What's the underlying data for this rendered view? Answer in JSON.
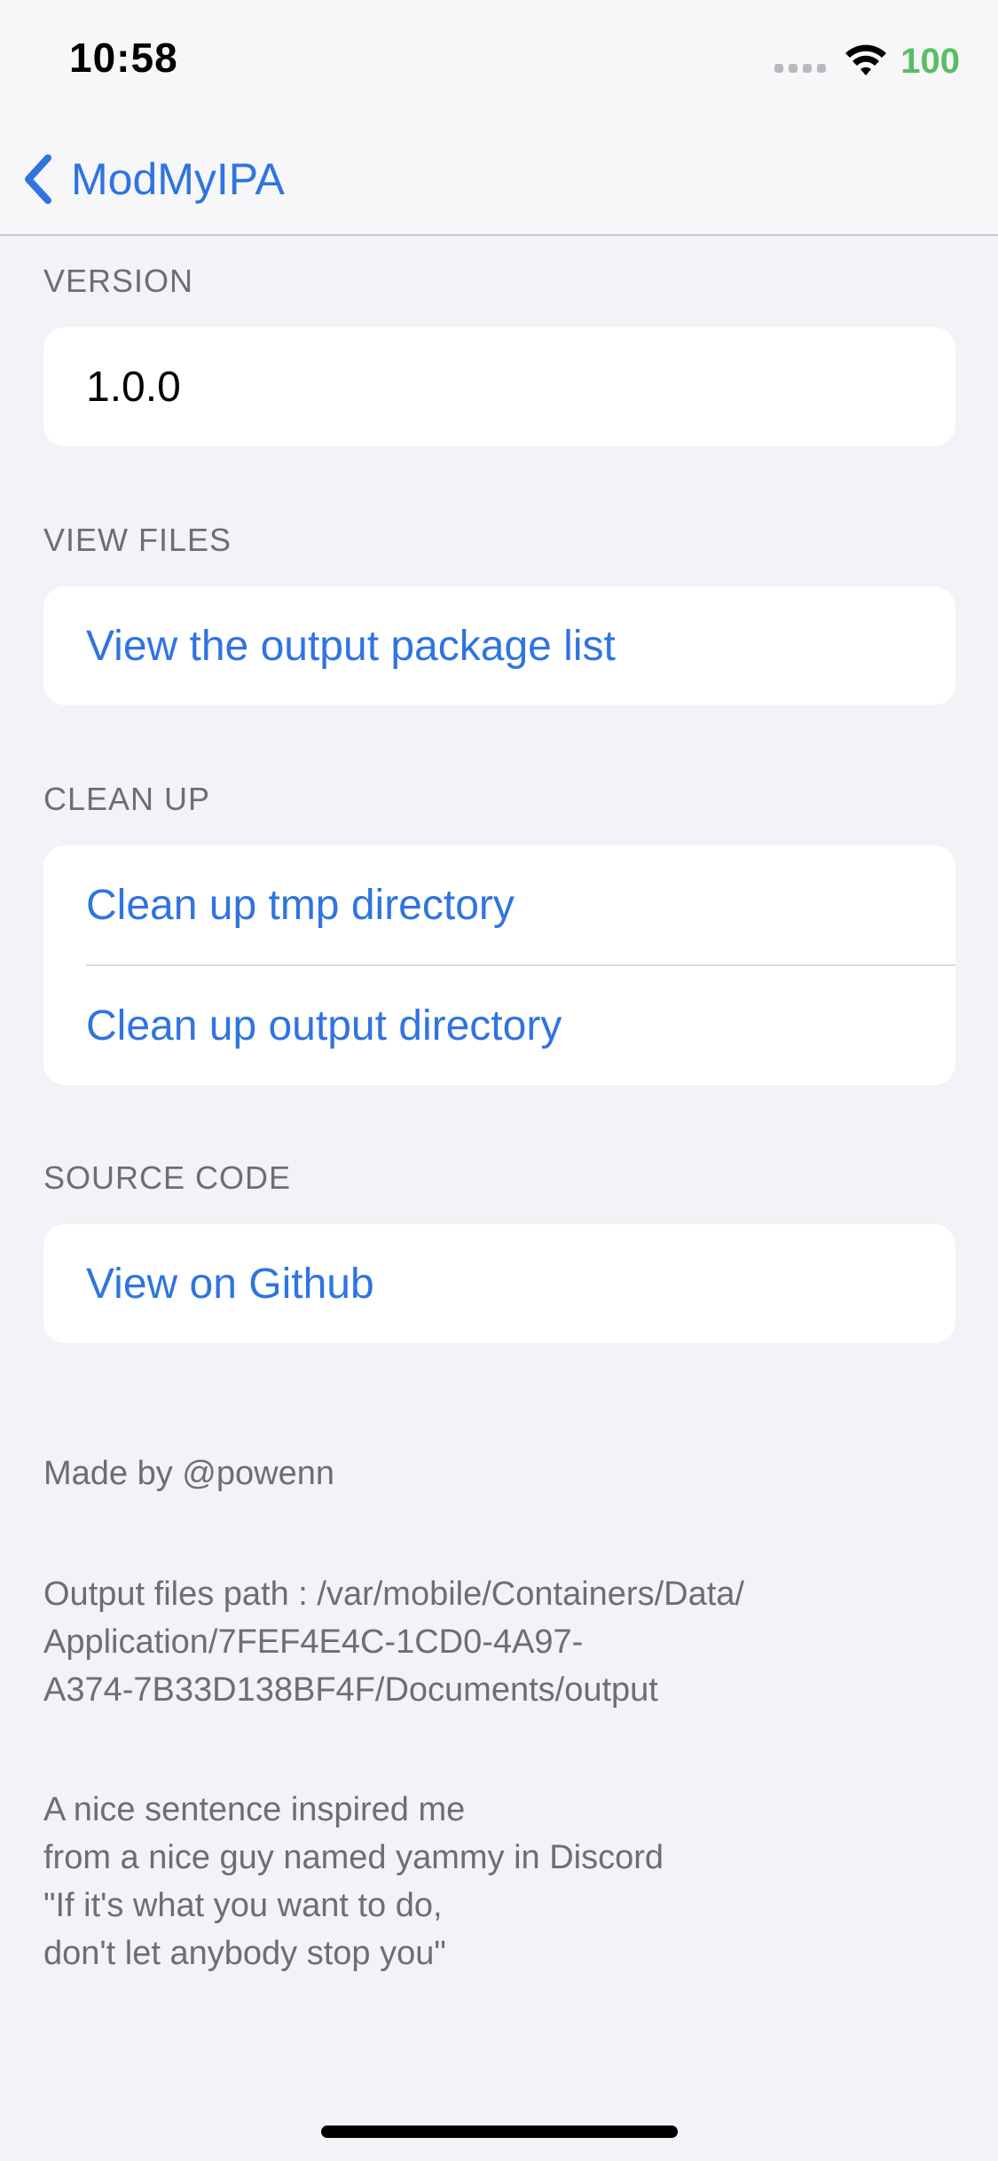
{
  "status_bar": {
    "time": "10:58",
    "battery": "100",
    "battery_color": "#58be62"
  },
  "nav": {
    "back_label": "ModMyIPA",
    "accent_color": "#2f74e0"
  },
  "sections": {
    "version": {
      "header": "VERSION",
      "value": "1.0.0"
    },
    "view_files": {
      "header": "VIEW FILES",
      "item": "View the output package list"
    },
    "clean_up": {
      "header": "CLEAN UP",
      "items": [
        "Clean up tmp directory",
        "Clean up output directory"
      ]
    },
    "source_code": {
      "header": "SOURCE CODE",
      "item": "View on Github"
    }
  },
  "footer": {
    "made_by": "Made by @powenn",
    "output_path": "Output files path : /var/mobile/Containers/Data/\nApplication/7FEF4E4C-1CD0-4A97-\nA374-7B33D138BF4F/Documents/output",
    "quote": "A nice sentence inspired me\nfrom a nice guy named yammy in Discord\n\"If it's what you want to do,\ndon't let anybody stop you\""
  }
}
